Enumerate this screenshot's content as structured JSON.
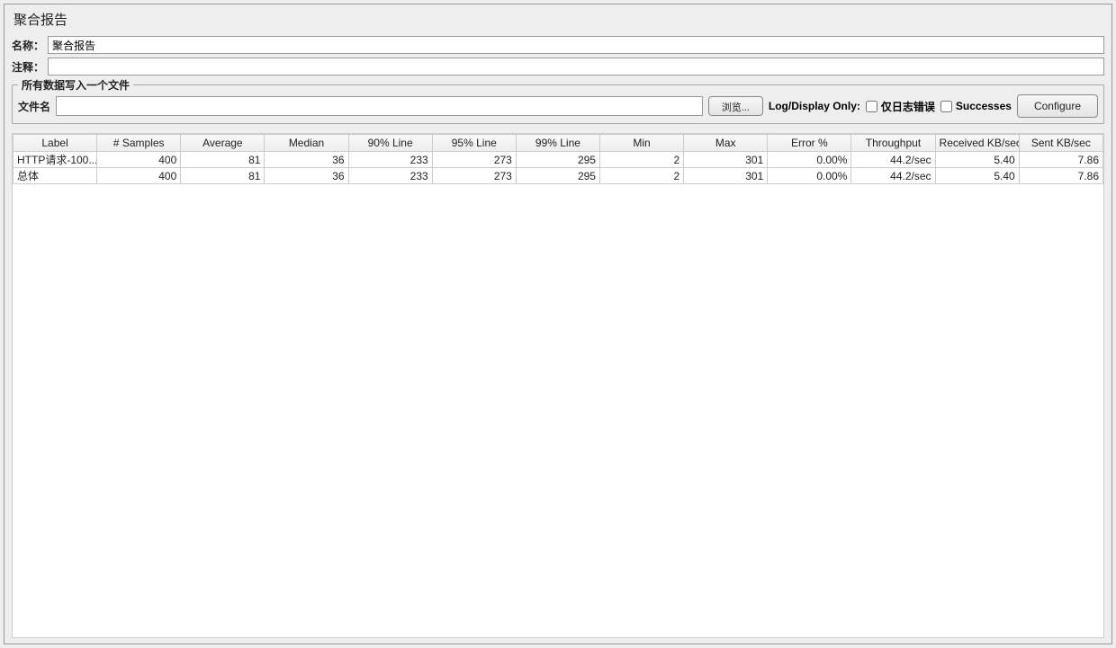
{
  "panel": {
    "title": "聚合报告"
  },
  "form": {
    "name_label": "名称：",
    "name_value": "聚合报告",
    "comment_label": "注释：",
    "comment_value": ""
  },
  "file_section": {
    "legend": "所有数据写入一个文件",
    "filename_label": "文件名",
    "filename_value": "",
    "browse_button": "浏览...",
    "log_display_label": "Log/Display Only:",
    "errors_only_label": "仅日志错误",
    "successes_label": "Successes",
    "configure_button": "Configure"
  },
  "table": {
    "headers": {
      "label": "Label",
      "samples": "# Samples",
      "average": "Average",
      "median": "Median",
      "line90": "90% Line",
      "line95": "95% Line",
      "line99": "99% Line",
      "min": "Min",
      "max": "Max",
      "error": "Error %",
      "throughput": "Throughput",
      "received": "Received KB/sec",
      "sent": "Sent KB/sec"
    },
    "rows": [
      {
        "label": "HTTP请求-100...",
        "samples": "400",
        "average": "81",
        "median": "36",
        "line90": "233",
        "line95": "273",
        "line99": "295",
        "min": "2",
        "max": "301",
        "error": "0.00%",
        "throughput": "44.2/sec",
        "received": "5.40",
        "sent": "7.86"
      },
      {
        "label": "总体",
        "samples": "400",
        "average": "81",
        "median": "36",
        "line90": "233",
        "line95": "273",
        "line99": "295",
        "min": "2",
        "max": "301",
        "error": "0.00%",
        "throughput": "44.2/sec",
        "received": "5.40",
        "sent": "7.86"
      }
    ]
  }
}
